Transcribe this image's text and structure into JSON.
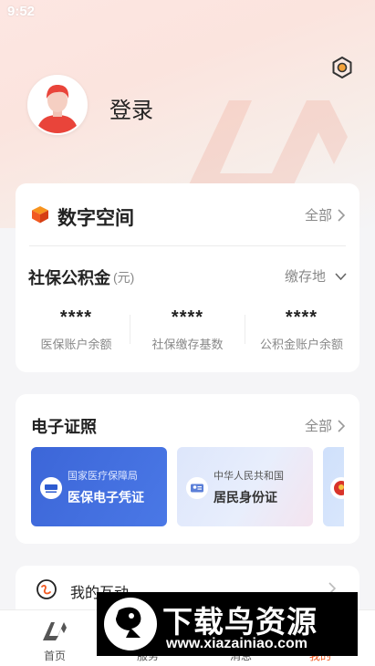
{
  "status_bar": {
    "time": "9:52"
  },
  "profile": {
    "login_label": "登录"
  },
  "digital_space": {
    "title": "数字空间",
    "more_label": "全部",
    "fund": {
      "title": "社保公积金",
      "unit": "(元)",
      "place_label": "缴存地",
      "stats": [
        {
          "value": "****",
          "label": "医保账户余额"
        },
        {
          "value": "****",
          "label": "社保缴存基数"
        },
        {
          "value": "****",
          "label": "公积金账户余额"
        }
      ]
    }
  },
  "certificates": {
    "title": "电子证照",
    "more_label": "全部",
    "items": [
      {
        "org": "国家医疗保障局",
        "name": "医保电子凭证"
      },
      {
        "org": "中华人民共和国",
        "name": "居民身份证"
      }
    ]
  },
  "interaction": {
    "label": "我的互动"
  },
  "tabbar": {
    "tabs": [
      {
        "label": "首页"
      },
      {
        "label": "服务"
      },
      {
        "label": "消息"
      },
      {
        "label": "我的"
      }
    ]
  },
  "watermark": {
    "title": "下载鸟资源",
    "url": "www.xiazainiao.com"
  },
  "colors": {
    "accent": "#f15a22",
    "medical_card": "#3c66d8",
    "background": "#f5f5f7"
  },
  "icons": [
    "settings-icon",
    "cube-icon",
    "chevron-right-icon",
    "chevron-down-icon",
    "medical-logo-icon",
    "id-card-icon",
    "chat-icon",
    "home-icon"
  ]
}
